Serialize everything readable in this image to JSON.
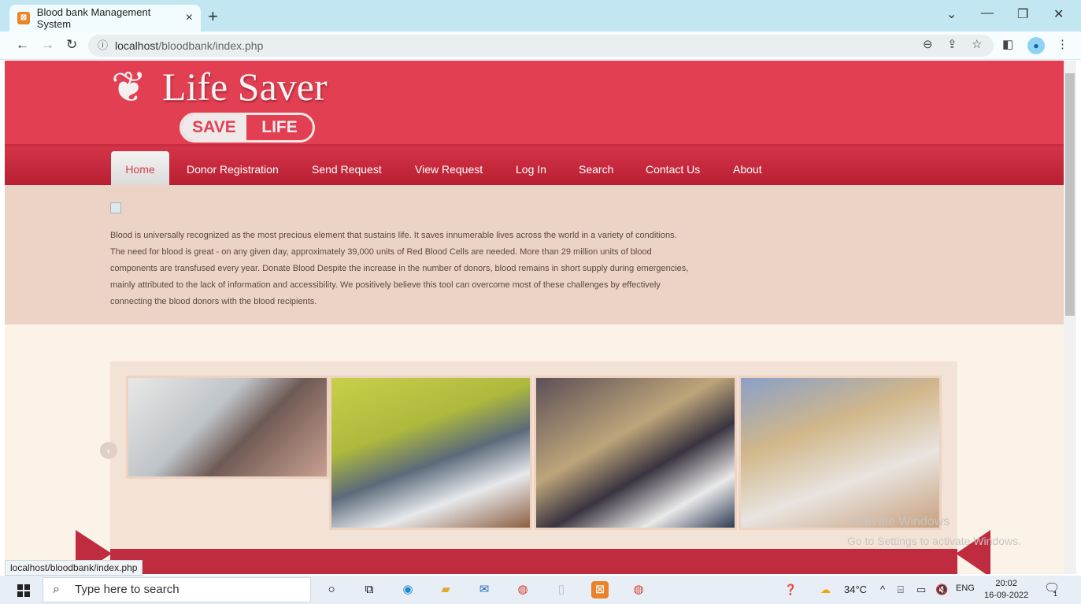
{
  "browser": {
    "tab_title": "Blood bank Management System",
    "tab_close": "×",
    "new_tab": "+",
    "url_host": "localhost",
    "url_path": "/bloodbank/index.php",
    "status_url": "localhost/bloodbank/index.php"
  },
  "site": {
    "logo_title": "Life Saver",
    "badge_save": "SAVE",
    "badge_life": "LIFE",
    "nav": [
      "Home",
      "Donor Registration",
      "Send Request",
      "View Request",
      "Log In",
      "Search",
      "Contact Us",
      "About"
    ],
    "intro_text": "Blood is universally recognized as the most precious element that sustains life. It saves innumerable lives across the world in a variety of conditions. The need for blood is great - on any given day, approximately 39,000 units of Red Blood Cells are needed. More than 29 million units of blood components are transfused every year. Donate Blood Despite the increase in the number of donors, blood remains in short supply during emergencies, mainly attributed to the lack of information and accessibility. We positively believe this tool can overcome most of these challenges by effectively connecting the blood donors with the blood recipients."
  },
  "watermark": {
    "line1": "Activate Windows",
    "line2": "Go to Settings to activate Windows."
  },
  "taskbar": {
    "search_placeholder": "Type here to search",
    "weather": "34°C",
    "language": "ENG",
    "time": "20:02",
    "date": "16-09-2022",
    "notification_count": "1"
  },
  "colors": {
    "brand": "#e23f52",
    "nav_dark": "#b81f33",
    "intro_bg": "#ecd3c6",
    "page_bg": "#fbf3e7"
  }
}
